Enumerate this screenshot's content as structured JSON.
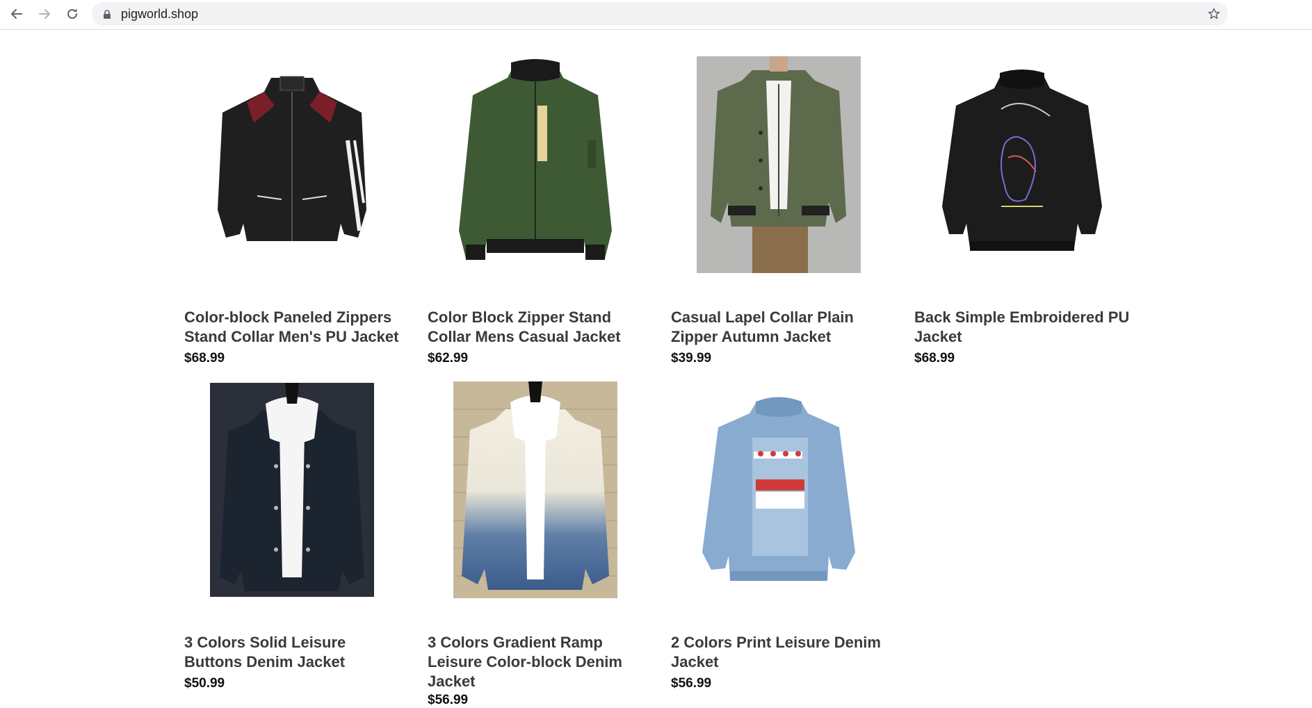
{
  "browser": {
    "url": "pigworld.shop"
  },
  "products": [
    {
      "name": "Color-block Paneled Zippers Stand Collar Men's PU Jacket",
      "price": "$68.99",
      "image": "black-red-leather-jacket"
    },
    {
      "name": "Color Block Zipper Stand Collar Mens Casual Jacket",
      "price": "$62.99",
      "image": "green-bomber-jacket"
    },
    {
      "name": "Casual Lapel Collar Plain Zipper Autumn Jacket",
      "price": "$39.99",
      "image": "olive-jacket-on-model"
    },
    {
      "name": "Back Simple Embroidered PU Jacket",
      "price": "$68.99",
      "image": "black-embroidered-pu-jacket"
    },
    {
      "name": "3 Colors Solid Leisure Buttons Denim Jacket",
      "price": "$50.99",
      "image": "dark-denim-jacket"
    },
    {
      "name": "3 Colors Gradient Ramp Leisure Color-block Denim Jacket",
      "price": "$56.99",
      "image": "gradient-denim-jacket"
    },
    {
      "name": "2 Colors Print Leisure Denim Jacket",
      "price": "$56.99",
      "image": "light-denim-print-jacket"
    }
  ]
}
